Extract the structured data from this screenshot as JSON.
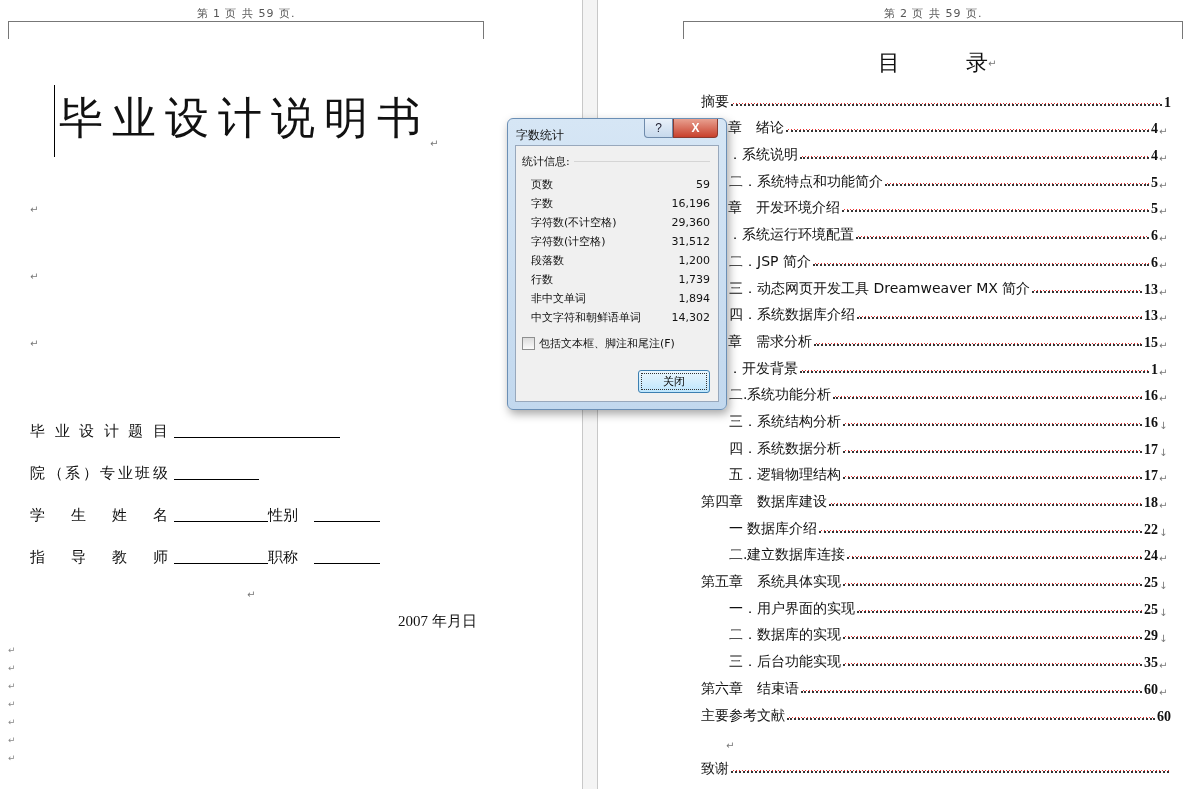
{
  "pages": [
    {
      "header": "第 1 页 共 59 页.",
      "title": "毕业设计说明书",
      "title_mark": "↵",
      "blank_marks": [
        "↵",
        "↵",
        "↵"
      ],
      "fields": [
        {
          "label": "毕业设计题目",
          "kind": "long"
        },
        {
          "label": "院（系）专业班级",
          "kind": "short"
        },
        {
          "label": "学生姓名",
          "kind": "pair",
          "second_label": "性别"
        },
        {
          "label": "指导教师",
          "kind": "pair",
          "second_label": "职称"
        }
      ],
      "center_mark": "↵",
      "date": "2007 年月日",
      "margin_marks": [
        "↵",
        "↵",
        "↵",
        "↵",
        "↵",
        "↵",
        "↵"
      ]
    },
    {
      "header": "第 2 页 共 59 页.",
      "title": "目　　　录",
      "title_mark": "↵",
      "toc": [
        {
          "kind": "chapter",
          "text": "摘要",
          "page": "1"
        },
        {
          "kind": "clipped",
          "text": "章　绪论",
          "page": "4",
          "mark": "↵"
        },
        {
          "kind": "clipped",
          "text": "．系统说明",
          "page": "4",
          "mark": "↵"
        },
        {
          "kind": "section",
          "text": "二．系统特点和功能简介",
          "page": "5",
          "mark": "↵"
        },
        {
          "kind": "clipped",
          "text": "章　开发环境介绍",
          "page": "5",
          "mark": "↵"
        },
        {
          "kind": "clipped",
          "text": "．系统运行环境配置",
          "page": "6",
          "mark": "↵"
        },
        {
          "kind": "section",
          "text": "二．JSP 简介",
          "page": "6",
          "mark": "↵"
        },
        {
          "kind": "section",
          "text": "三．动态网页开发工具 Dreamweaver MX 简介",
          "page": "13",
          "mark": "↵"
        },
        {
          "kind": "section",
          "text": "四．系统数据库介绍",
          "page": "13",
          "mark": "↵"
        },
        {
          "kind": "clipped",
          "text": "章　需求分析",
          "page": "15",
          "mark": "↵"
        },
        {
          "kind": "clipped",
          "text": "．开发背景",
          "page": "1",
          "mark": "↵"
        },
        {
          "kind": "section",
          "text": "二.系统功能分析",
          "page": "16",
          "mark": "↵"
        },
        {
          "kind": "section",
          "text": "三．系统结构分析",
          "page": "16",
          "mark": "↓"
        },
        {
          "kind": "section",
          "text": "四．系统数据分析",
          "page": "17",
          "mark": "↓"
        },
        {
          "kind": "section",
          "text": "五．逻辑物理结构",
          "page": "17",
          "mark": "↵"
        },
        {
          "kind": "chapter",
          "text": "第四章　数据库建设",
          "page": "18",
          "mark": "↵"
        },
        {
          "kind": "section",
          "text": "一 数据库介绍",
          "page": "22",
          "mark": "↓"
        },
        {
          "kind": "section",
          "text": "二.建立数据库连接",
          "page": "24",
          "mark": "↵"
        },
        {
          "kind": "chapter",
          "text": "第五章　系统具体实现",
          "page": "25",
          "mark": "↓"
        },
        {
          "kind": "section",
          "text": "一．用户界面的实现",
          "page": "25",
          "mark": "↓"
        },
        {
          "kind": "section",
          "text": "二．数据库的实现",
          "page": "29",
          "mark": "↓"
        },
        {
          "kind": "section",
          "text": "三．后台功能实现",
          "page": "35",
          "mark": "↵"
        },
        {
          "kind": "chapter",
          "text": "第六章　结束语",
          "page": "60",
          "mark": "↵"
        },
        {
          "kind": "chapter",
          "text": "主要参考文献",
          "page": "60"
        },
        {
          "kind": "blank",
          "mark": "↵"
        },
        {
          "kind": "chapter",
          "text": "致谢"
        }
      ]
    }
  ],
  "dialog": {
    "title": "字数统计",
    "help": "?",
    "close": "X",
    "group": "统计信息:",
    "stats": [
      {
        "label": "页数",
        "value": "59"
      },
      {
        "label": "字数",
        "value": "16,196"
      },
      {
        "label": "字符数(不计空格)",
        "value": "29,360"
      },
      {
        "label": "字符数(计空格)",
        "value": "31,512"
      },
      {
        "label": "段落数",
        "value": "1,200"
      },
      {
        "label": "行数",
        "value": "1,739"
      },
      {
        "label": "非中文单词",
        "value": "1,894"
      },
      {
        "label": "中文字符和朝鲜语单词",
        "value": "14,302"
      }
    ],
    "checkbox": {
      "label": "包括文本框、脚注和尾注(F)",
      "checked": false
    },
    "button": "关闭"
  }
}
